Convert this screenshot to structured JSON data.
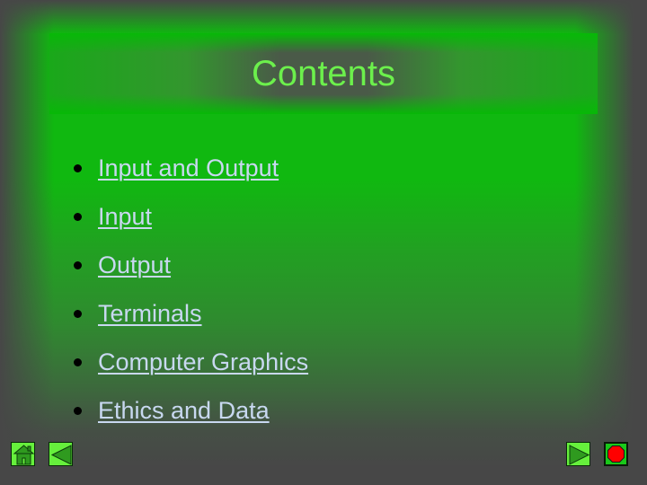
{
  "slide": {
    "title": "Contents",
    "items": [
      {
        "label": "Input and Output"
      },
      {
        "label": "Input"
      },
      {
        "label": "Output"
      },
      {
        "label": "Terminals"
      },
      {
        "label": "Computer Graphics"
      },
      {
        "label": "Ethics and Data"
      }
    ]
  },
  "nav": {
    "home": {
      "icon": "home-icon"
    },
    "back": {
      "icon": "triangle-left-icon"
    },
    "next": {
      "icon": "triangle-right-icon"
    },
    "end": {
      "icon": "stop-octagon-icon"
    }
  },
  "colors": {
    "panel_green": "#10b810",
    "title_text": "#6cf04c",
    "link_text": "#c8d8f0",
    "background": "#474747",
    "button_fill": "#66f03c",
    "stop_red": "#ff0000"
  }
}
